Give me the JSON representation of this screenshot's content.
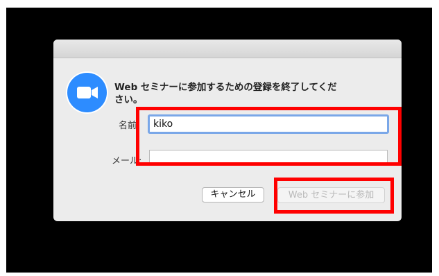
{
  "dialog": {
    "message": "Web セミナーに参加するための登録を終了してください。",
    "app_icon": "zoom-video-camera-icon",
    "accent_color": "#2d8cff"
  },
  "form": {
    "name_label": "名前:",
    "name_value": "kiko",
    "email_label": "メール:",
    "email_value": ""
  },
  "buttons": {
    "cancel_label": "キャンセル",
    "join_label": "Web セミナーに参加"
  },
  "annotations": {
    "highlight_color": "#ff0000"
  }
}
